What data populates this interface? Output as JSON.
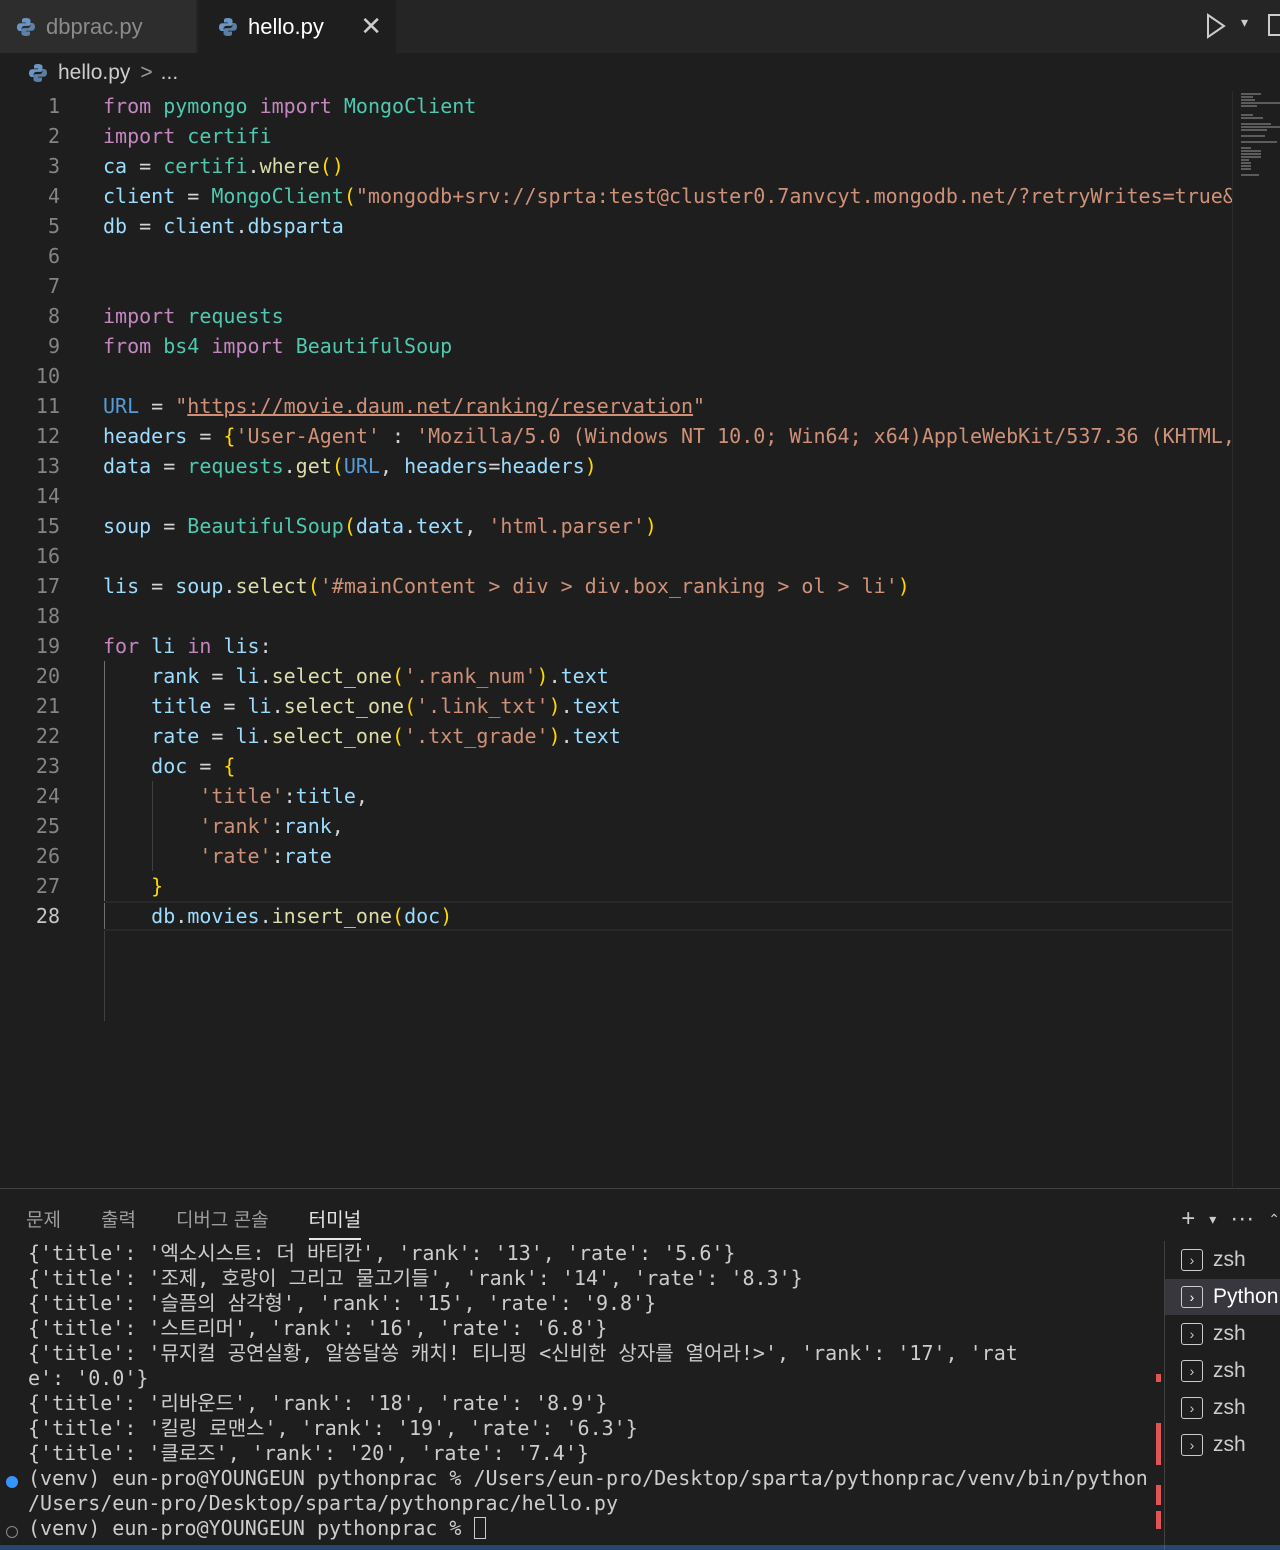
{
  "tabs": [
    {
      "label": "dbprac.py",
      "active": false
    },
    {
      "label": "hello.py",
      "active": true
    }
  ],
  "tab_close_glyph": "✕",
  "breadcrumb": {
    "file": "hello.py",
    "sep": ">",
    "more": "..."
  },
  "code_lines": [
    {
      "n": "1",
      "tokens": [
        [
          "kw",
          "from"
        ],
        [
          "op",
          " "
        ],
        [
          "cls",
          "pymongo"
        ],
        [
          "op",
          " "
        ],
        [
          "kw",
          "import"
        ],
        [
          "op",
          " "
        ],
        [
          "cls",
          "MongoClient"
        ]
      ]
    },
    {
      "n": "2",
      "tokens": [
        [
          "kw",
          "import"
        ],
        [
          "op",
          " "
        ],
        [
          "cls",
          "certifi"
        ]
      ]
    },
    {
      "n": "3",
      "tokens": [
        [
          "var",
          "ca"
        ],
        [
          "op",
          " = "
        ],
        [
          "cls",
          "certifi"
        ],
        [
          "op",
          "."
        ],
        [
          "fn",
          "where"
        ],
        [
          "br",
          "()"
        ]
      ]
    },
    {
      "n": "4",
      "tokens": [
        [
          "var",
          "client"
        ],
        [
          "op",
          " = "
        ],
        [
          "cls",
          "MongoClient"
        ],
        [
          "br",
          "("
        ],
        [
          "str",
          "\"mongodb+srv://sprta:test@cluster0.7anvcyt.mongodb.net/?retryWrites=true&"
        ]
      ]
    },
    {
      "n": "5",
      "tokens": [
        [
          "var",
          "db"
        ],
        [
          "op",
          " = "
        ],
        [
          "var",
          "client"
        ],
        [
          "op",
          "."
        ],
        [
          "var",
          "dbsparta"
        ]
      ]
    },
    {
      "n": "6",
      "tokens": []
    },
    {
      "n": "7",
      "tokens": []
    },
    {
      "n": "8",
      "tokens": [
        [
          "kw",
          "import"
        ],
        [
          "op",
          " "
        ],
        [
          "cls",
          "requests"
        ]
      ]
    },
    {
      "n": "9",
      "tokens": [
        [
          "kw",
          "from"
        ],
        [
          "op",
          " "
        ],
        [
          "cls",
          "bs4"
        ],
        [
          "op",
          " "
        ],
        [
          "kw",
          "import"
        ],
        [
          "op",
          " "
        ],
        [
          "cls",
          "BeautifulSoup"
        ]
      ]
    },
    {
      "n": "10",
      "tokens": []
    },
    {
      "n": "11",
      "tokens": [
        [
          "bl",
          "URL"
        ],
        [
          "op",
          " = "
        ],
        [
          "str",
          "\""
        ],
        [
          "link",
          "https://movie.daum.net/ranking/reservation"
        ],
        [
          "str",
          "\""
        ]
      ]
    },
    {
      "n": "12",
      "tokens": [
        [
          "var",
          "headers"
        ],
        [
          "op",
          " = "
        ],
        [
          "br",
          "{"
        ],
        [
          "str",
          "'User-Agent'"
        ],
        [
          "op",
          " : "
        ],
        [
          "str",
          "'Mozilla/5.0 (Windows NT 10.0; Win64; x64)AppleWebKit/537.36 (KHTML,"
        ]
      ]
    },
    {
      "n": "13",
      "tokens": [
        [
          "var",
          "data"
        ],
        [
          "op",
          " = "
        ],
        [
          "cls",
          "requests"
        ],
        [
          "op",
          "."
        ],
        [
          "fn",
          "get"
        ],
        [
          "br",
          "("
        ],
        [
          "bl",
          "URL"
        ],
        [
          "op",
          ", "
        ],
        [
          "var",
          "headers"
        ],
        [
          "op",
          "="
        ],
        [
          "var",
          "headers"
        ],
        [
          "br",
          ")"
        ]
      ]
    },
    {
      "n": "14",
      "tokens": []
    },
    {
      "n": "15",
      "tokens": [
        [
          "var",
          "soup"
        ],
        [
          "op",
          " = "
        ],
        [
          "cls",
          "BeautifulSoup"
        ],
        [
          "br",
          "("
        ],
        [
          "var",
          "data"
        ],
        [
          "op",
          "."
        ],
        [
          "var",
          "text"
        ],
        [
          "op",
          ", "
        ],
        [
          "str",
          "'html.parser'"
        ],
        [
          "br",
          ")"
        ]
      ]
    },
    {
      "n": "16",
      "tokens": []
    },
    {
      "n": "17",
      "tokens": [
        [
          "var",
          "lis"
        ],
        [
          "op",
          " = "
        ],
        [
          "var",
          "soup"
        ],
        [
          "op",
          "."
        ],
        [
          "fn",
          "select"
        ],
        [
          "br",
          "("
        ],
        [
          "str",
          "'#mainContent > div > div.box_ranking > ol > li'"
        ],
        [
          "br",
          ")"
        ]
      ]
    },
    {
      "n": "18",
      "tokens": []
    },
    {
      "n": "19",
      "tokens": [
        [
          "kw",
          "for"
        ],
        [
          "op",
          " "
        ],
        [
          "var",
          "li"
        ],
        [
          "op",
          " "
        ],
        [
          "kw",
          "in"
        ],
        [
          "op",
          " "
        ],
        [
          "var",
          "lis"
        ],
        [
          "op",
          ":"
        ]
      ]
    },
    {
      "n": "20",
      "tokens": [
        [
          "op",
          "    "
        ],
        [
          "var",
          "rank"
        ],
        [
          "op",
          " = "
        ],
        [
          "var",
          "li"
        ],
        [
          "op",
          "."
        ],
        [
          "fn",
          "select_one"
        ],
        [
          "br",
          "("
        ],
        [
          "str",
          "'.rank_num'"
        ],
        [
          "br",
          ")"
        ],
        [
          "op",
          "."
        ],
        [
          "var",
          "text"
        ]
      ]
    },
    {
      "n": "21",
      "tokens": [
        [
          "op",
          "    "
        ],
        [
          "var",
          "title"
        ],
        [
          "op",
          " = "
        ],
        [
          "var",
          "li"
        ],
        [
          "op",
          "."
        ],
        [
          "fn",
          "select_one"
        ],
        [
          "br",
          "("
        ],
        [
          "str",
          "'.link_txt'"
        ],
        [
          "br",
          ")"
        ],
        [
          "op",
          "."
        ],
        [
          "var",
          "text"
        ]
      ]
    },
    {
      "n": "22",
      "tokens": [
        [
          "op",
          "    "
        ],
        [
          "var",
          "rate"
        ],
        [
          "op",
          " = "
        ],
        [
          "var",
          "li"
        ],
        [
          "op",
          "."
        ],
        [
          "fn",
          "select_one"
        ],
        [
          "br",
          "("
        ],
        [
          "str",
          "'.txt_grade'"
        ],
        [
          "br",
          ")"
        ],
        [
          "op",
          "."
        ],
        [
          "var",
          "text"
        ]
      ]
    },
    {
      "n": "23",
      "tokens": [
        [
          "op",
          "    "
        ],
        [
          "var",
          "doc"
        ],
        [
          "op",
          " = "
        ],
        [
          "br",
          "{"
        ]
      ]
    },
    {
      "n": "24",
      "tokens": [
        [
          "op",
          "        "
        ],
        [
          "str",
          "'title'"
        ],
        [
          "op",
          ":"
        ],
        [
          "var",
          "title"
        ],
        [
          "op",
          ","
        ]
      ]
    },
    {
      "n": "25",
      "tokens": [
        [
          "op",
          "        "
        ],
        [
          "str",
          "'rank'"
        ],
        [
          "op",
          ":"
        ],
        [
          "var",
          "rank"
        ],
        [
          "op",
          ","
        ]
      ]
    },
    {
      "n": "26",
      "tokens": [
        [
          "op",
          "        "
        ],
        [
          "str",
          "'rate'"
        ],
        [
          "op",
          ":"
        ],
        [
          "var",
          "rate"
        ]
      ]
    },
    {
      "n": "27",
      "tokens": [
        [
          "op",
          "    "
        ],
        [
          "br",
          "}"
        ]
      ]
    },
    {
      "n": "28",
      "tokens": [
        [
          "op",
          "    "
        ],
        [
          "var",
          "db"
        ],
        [
          "op",
          "."
        ],
        [
          "var",
          "movies"
        ],
        [
          "op",
          "."
        ],
        [
          "fn",
          "insert_one"
        ],
        [
          "br",
          "("
        ],
        [
          "var",
          "doc"
        ],
        [
          "br",
          ")"
        ]
      ],
      "current": true
    }
  ],
  "panel": {
    "tabs": [
      "문제",
      "출력",
      "디버그 콘솔",
      "터미널"
    ],
    "active_tab": 3,
    "add_glyph": "+",
    "chevron_glyph": "⌄",
    "more_glyph": "···"
  },
  "terminal_lines": [
    "{'title': '엑소시스트: 더 바티칸', 'rank': '13', 'rate': '5.6'}",
    "{'title': '조제, 호랑이 그리고 물고기들', 'rank': '14', 'rate': '8.3'}",
    "{'title': '슬픔의 삼각형', 'rank': '15', 'rate': '9.8'}",
    "{'title': '스트리머', 'rank': '16', 'rate': '6.8'}",
    "{'title': '뮤지컬 공연실황, 알쏭달쏭 캐치! 티니핑 <신비한 상자를 열어라!>', 'rank': '17', 'rat",
    "e': '0.0'}",
    "{'title': '리바운드', 'rank': '18', 'rate': '8.9'}",
    "{'title': '킬링 로맨스', 'rank': '19', 'rate': '6.3'}",
    "{'title': '클로즈', 'rank': '20', 'rate': '7.4'}",
    "(venv) eun-pro@YOUNGEUN pythonprac % /Users/eun-pro/Desktop/sparta/pythonprac/venv/bin/python",
    "/Users/eun-pro/Desktop/sparta/pythonprac/hello.py",
    "(venv) eun-pro@YOUNGEUN pythonprac % "
  ],
  "terminal_instances": [
    {
      "label": "zsh",
      "active": false
    },
    {
      "label": "Python",
      "active": true
    },
    {
      "label": "zsh",
      "active": false
    },
    {
      "label": "zsh",
      "active": false
    },
    {
      "label": "zsh",
      "active": false
    },
    {
      "label": "zsh",
      "active": false
    }
  ],
  "colors": {
    "keyword": "#c586c0",
    "variable": "#9cdcfe",
    "class": "#4ec9b0",
    "function": "#dcdcaa",
    "string": "#ce9178",
    "bracket": "#ffd700",
    "accent": "#3794ff",
    "error_mark": "#e05454"
  }
}
